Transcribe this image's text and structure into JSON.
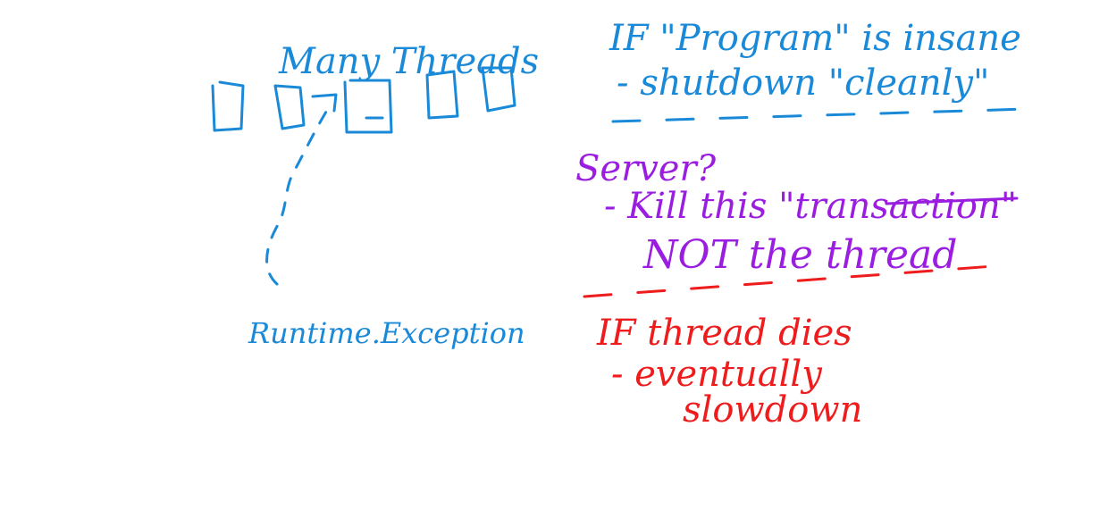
{
  "left": {
    "title": "Many Threads",
    "caller": "Runtime.Exception"
  },
  "notes": {
    "block1": {
      "line1": "IF \"Program\" is insane",
      "line2": "- shutdown \"cleanly\""
    },
    "block2": {
      "line1": "Server?",
      "line2": "- Kill this \"transaction\"",
      "line3": "NOT the thread"
    },
    "block3": {
      "line1": "IF thread dies",
      "line2": "- eventually",
      "line3": "slowdown"
    }
  },
  "colors": {
    "blue": "#1a8ad8",
    "purple": "#9a1de0",
    "red": "#ee1c1c"
  }
}
